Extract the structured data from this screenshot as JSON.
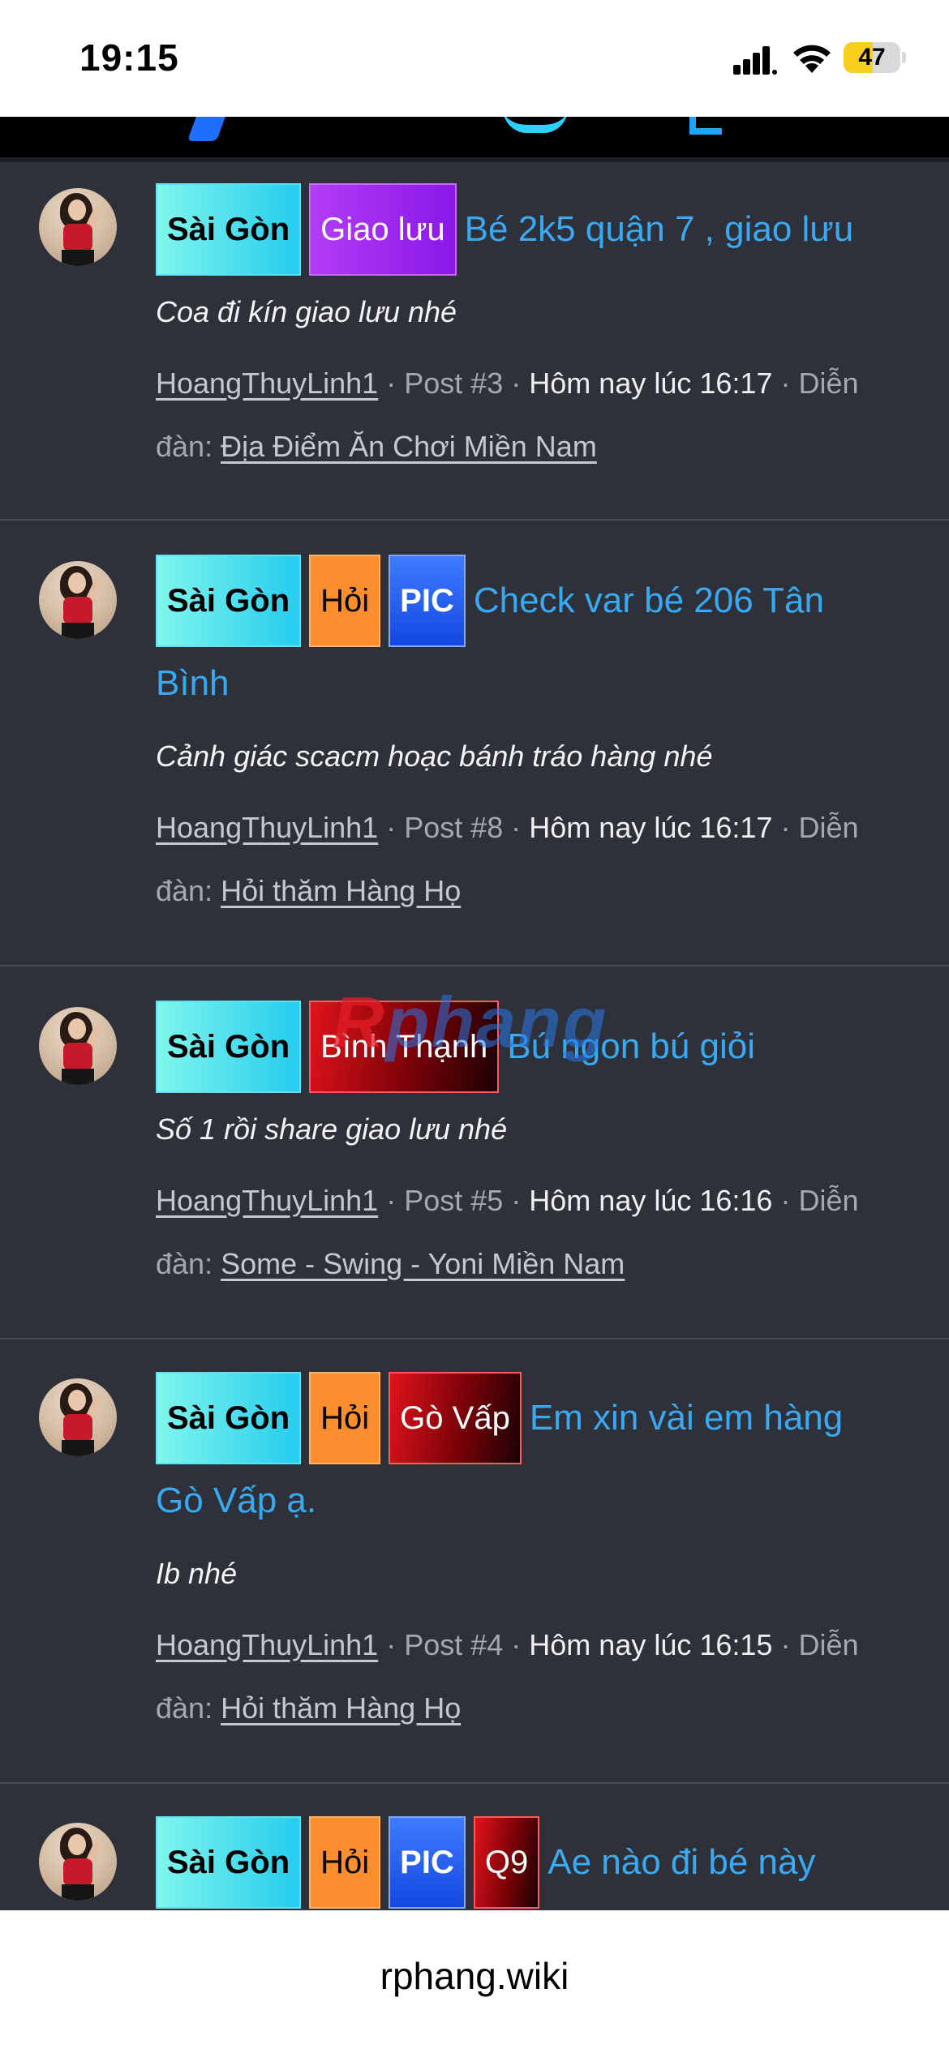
{
  "status": {
    "time": "19:15",
    "battery": "47"
  },
  "threads": [
    {
      "tags": [
        "Sài Gòn",
        "Giao lưu"
      ],
      "title_line1": "Bé 2k5 quận 7 , giao lưu",
      "title_line2": "",
      "snippet": "Coa đi kín giao lưu nhé",
      "user": "HoangThuyLinh1",
      "post": " · Post #3 · ",
      "date": "Hôm nay lúc 16:17",
      "forum_prefix": " · Diễn",
      "forum_label": "đàn: ",
      "forum": "Địa Điểm Ăn Chơi Miền Nam"
    },
    {
      "tags": [
        "Sài Gòn",
        "Hỏi",
        "PIC"
      ],
      "title_line1": "Check var bé 206 Tân",
      "title_line2": "Bình",
      "snippet": "Cảnh giác scacm hoạc bánh tráo hàng nhé",
      "user": "HoangThuyLinh1",
      "post": " · Post #8 · ",
      "date": "Hôm nay lúc 16:17",
      "forum_prefix": " · Diễn",
      "forum_label": "đàn: ",
      "forum": "Hỏi thăm Hàng Họ"
    },
    {
      "tags": [
        "Sài Gòn",
        "Bình Thạnh"
      ],
      "title_line1": "Bú ngon bú giỏi",
      "title_line2": "",
      "snippet": "Số 1 rồi share giao lưu nhé",
      "user": "HoangThuyLinh1",
      "post": " · Post #5 · ",
      "date": "Hôm nay lúc 16:16",
      "forum_prefix": " · Diễn",
      "forum_label": "đàn: ",
      "forum": "Some - Swing - Yoni Miền Nam"
    },
    {
      "tags": [
        "Sài Gòn",
        "Hỏi",
        "Gò Vấp"
      ],
      "title_line1": "Em xin vài em hàng",
      "title_line2": "Gò Vấp ạ.",
      "snippet": "Ib nhé",
      "user": "HoangThuyLinh1",
      "post": " · Post #4 · ",
      "date": "Hôm nay lúc 16:15",
      "forum_prefix": " · Diễn",
      "forum_label": "đàn: ",
      "forum": "Hỏi thăm Hàng Họ"
    },
    {
      "tags": [
        "Sài Gòn",
        "Hỏi",
        "PIC",
        "Q9"
      ],
      "title_line1": "Ae nào đi bé này",
      "title_line2": ""
    }
  ],
  "watermark": {
    "r": "R",
    "rest": "phang"
  },
  "browser": {
    "url": "rphang.wiki"
  },
  "colors": {
    "background": "#2e313a",
    "link": "#39a9f2",
    "tag_hoi": "#fb8e2e"
  }
}
